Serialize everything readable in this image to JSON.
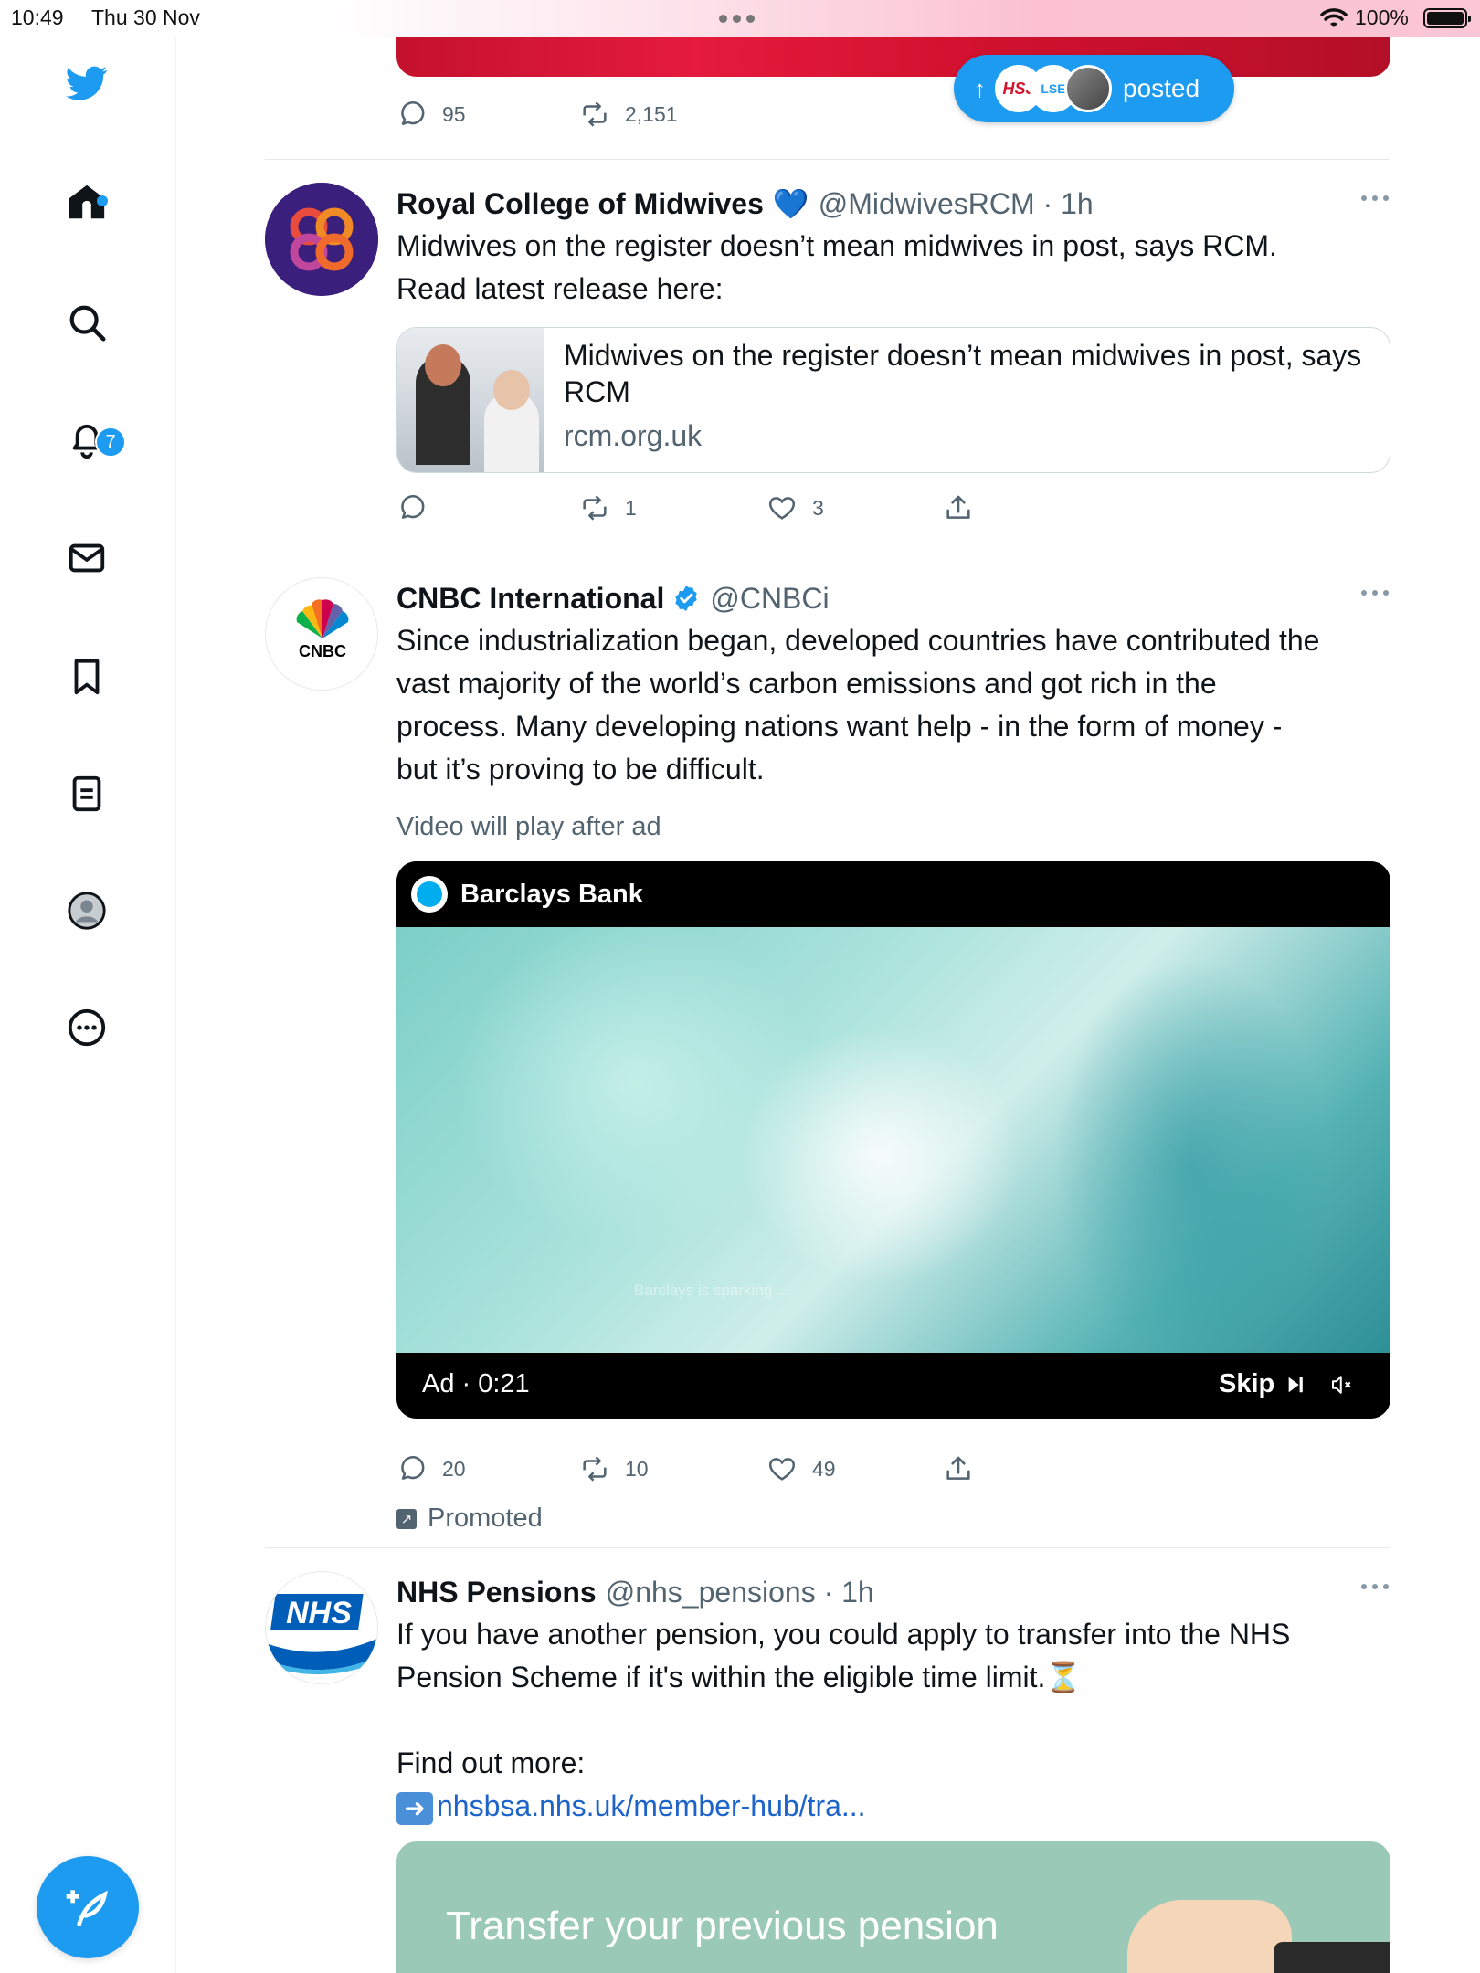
{
  "status_bar": {
    "time": "10:49",
    "date": "Thu 30 Nov",
    "battery": "100%"
  },
  "colors": {
    "brand_blue": "#1d9bf0",
    "text_primary": "#0f1419",
    "text_secondary": "#536471",
    "link_blue": "#1d63c9"
  },
  "sidebar": {
    "items": [
      {
        "icon": "twitter-logo-icon"
      },
      {
        "icon": "home-icon"
      },
      {
        "icon": "search-icon"
      },
      {
        "icon": "notifications-bell-icon",
        "badge": "7"
      },
      {
        "icon": "messages-envelope-icon"
      },
      {
        "icon": "bookmark-icon"
      },
      {
        "icon": "lists-icon"
      },
      {
        "icon": "profile-avatar-icon"
      },
      {
        "icon": "more-circle-icon"
      }
    ],
    "compose_icon": "compose-feather-icon"
  },
  "new_posts_pill": {
    "label": "posted",
    "avatar_hsj": "HSJ",
    "avatar_lse": "LSE"
  },
  "previous_tweet": {
    "replies": "95",
    "retweets": "2,151"
  },
  "tweets": [
    {
      "name": "Royal College of Midwives",
      "verified_emoji": "💙",
      "handle": "@MidwivesRCM · 1h",
      "text_lines": [
        "Midwives on the register doesn’t mean midwives in post, says RCM.",
        "Read latest release here:"
      ],
      "card": {
        "title": "Midwives on the register doesn’t mean midwives in post, says RCM",
        "domain": "rcm.org.uk"
      },
      "replies": "",
      "retweets": "1",
      "likes": "3"
    },
    {
      "name": "CNBC International",
      "handle": "@CNBCi",
      "text_lines": [
        "Since industrialization began, developed countries have contributed the",
        "vast majority of the world’s carbon emissions and got rich in the",
        "process. Many developing nations want help - in the form of money -",
        "but it’s proving to be difficult."
      ],
      "video_note": "Video will play after ad",
      "video": {
        "advertiser": "Barclays Bank",
        "caption": "Barclays is sparking ...",
        "ad_time": "Ad · 0:21",
        "skip_label": "Skip"
      },
      "replies": "20",
      "retweets": "10",
      "likes": "49",
      "promoted_label": "Promoted"
    },
    {
      "name": "NHS Pensions",
      "handle": "@nhs_pensions · 1h",
      "text_lines": [
        "If you have another pension, you could apply to transfer into the NHS",
        "Pension Scheme if it's within the eligible time limit.⏳"
      ],
      "find_more": "Find out more:",
      "link": "nhsbsa.nhs.uk/member-hub/tra...",
      "banner_text": "Transfer your previous pension"
    }
  ]
}
